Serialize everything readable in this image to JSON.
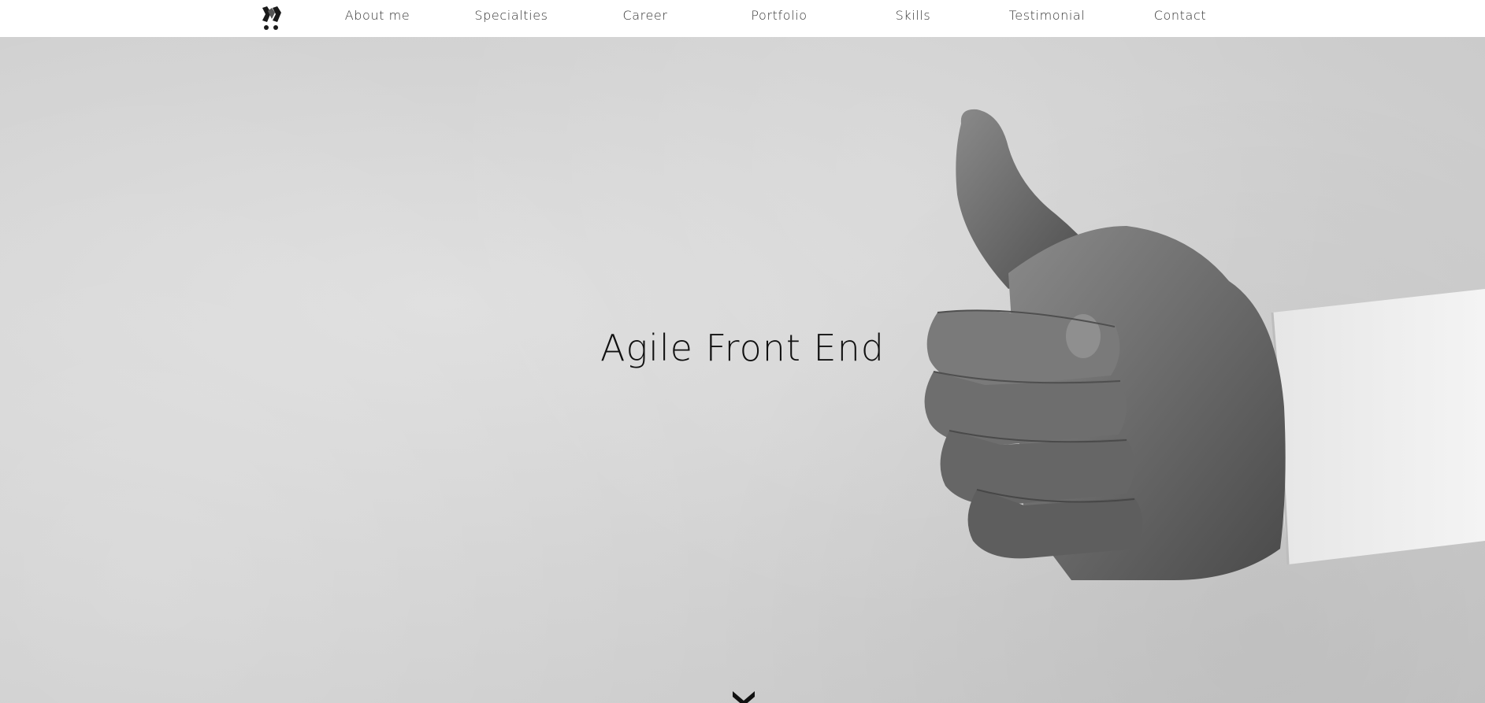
{
  "nav": {
    "items": [
      {
        "label": "About me"
      },
      {
        "label": "Specialties"
      },
      {
        "label": "Career"
      },
      {
        "label": "Portfolio"
      },
      {
        "label": "Skills"
      },
      {
        "label": "Testimonial"
      },
      {
        "label": "Contact"
      }
    ]
  },
  "hero": {
    "title": "Agile Front End"
  },
  "colors": {
    "nav_background": "#ffffff",
    "nav_text": "#333333",
    "hero_title": "#111111"
  },
  "icons": {
    "logo": "brand-logo-icon",
    "scroll": "double-chevron-down-icon"
  }
}
